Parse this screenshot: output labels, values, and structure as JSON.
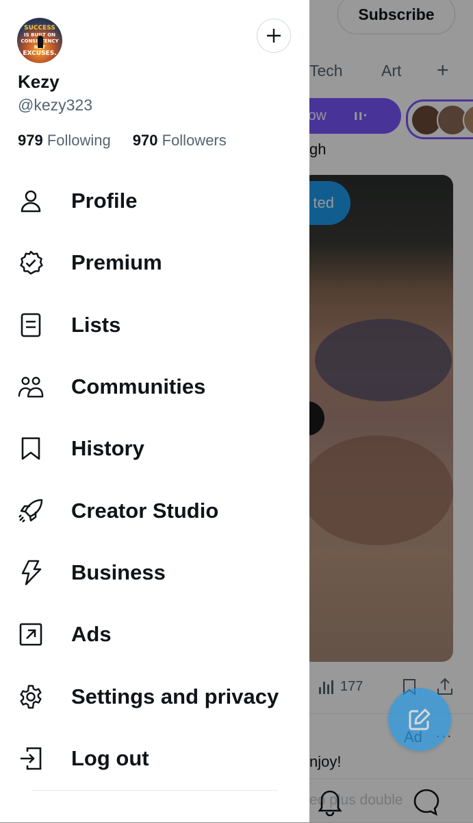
{
  "profile": {
    "avatar_text": [
      "SUCCESS",
      "IS BUILT ON",
      "CONSISTENCY",
      "NOT",
      "EXCUSES."
    ],
    "name": "Kezy",
    "handle": "@kezy323",
    "following_count": "979",
    "following_label": "Following",
    "followers_count": "970",
    "followers_label": "Followers"
  },
  "menu": [
    {
      "label": "Profile",
      "icon": "person-icon"
    },
    {
      "label": "Premium",
      "icon": "verified-badge-icon"
    },
    {
      "label": "Lists",
      "icon": "list-icon"
    },
    {
      "label": "Communities",
      "icon": "communities-icon"
    },
    {
      "label": "History",
      "icon": "bookmark-icon"
    },
    {
      "label": "Creator Studio",
      "icon": "rocket-icon"
    },
    {
      "label": "Business",
      "icon": "lightning-icon"
    },
    {
      "label": "Ads",
      "icon": "arrow-up-right-box-icon"
    },
    {
      "label": "Settings and privacy",
      "icon": "gear-icon"
    },
    {
      "label": "Log out",
      "icon": "logout-icon"
    }
  ],
  "background": {
    "subscribe_label": "Subscribe",
    "tabs": [
      "Tech",
      "Art"
    ],
    "tab_add": "+",
    "spaces_text": "ow",
    "spaces_bars": "ıı·",
    "feed_text_1": "gh",
    "badge_text": "ted",
    "views_count": "177",
    "ad_label": "Ad",
    "more": "···",
    "feed_text_2": "njoy!",
    "ghost_text": "eo plus double"
  },
  "colors": {
    "accent": "#1d9bf0",
    "spaces": "#7856ff",
    "text_primary": "#0f1419",
    "text_secondary": "#536471"
  }
}
